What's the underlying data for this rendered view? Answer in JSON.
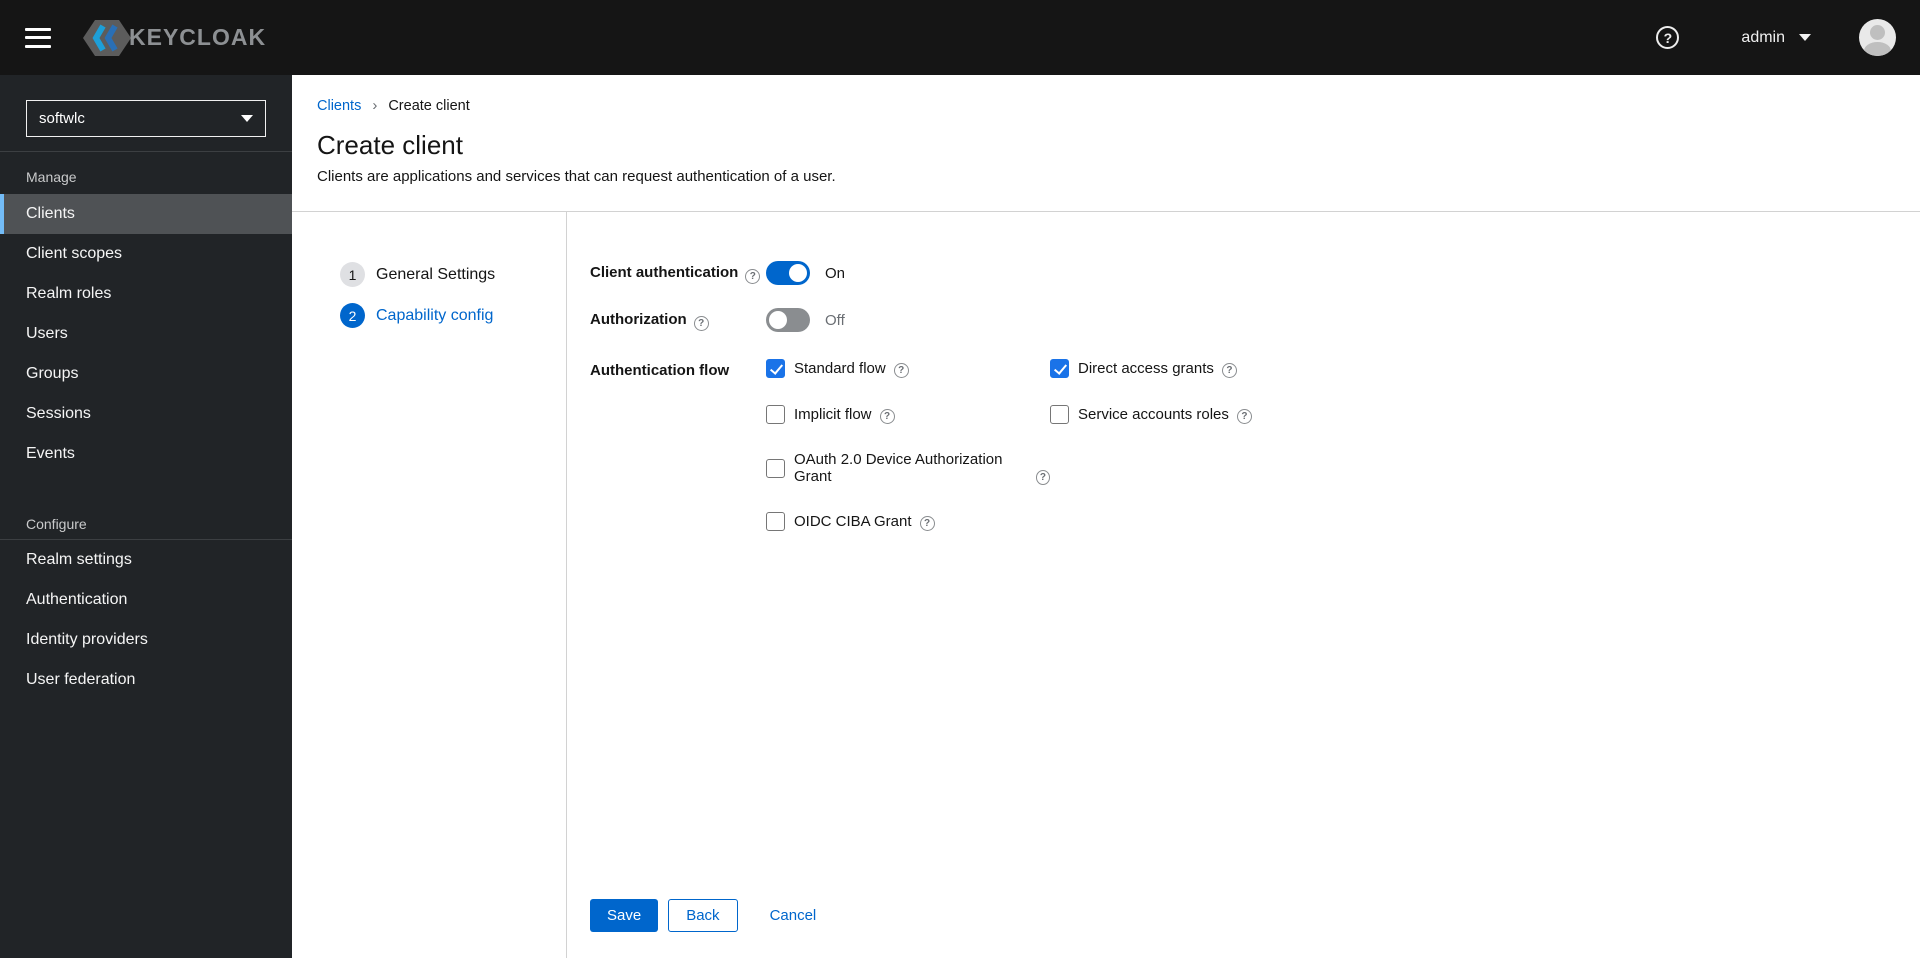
{
  "masthead": {
    "brand": "KEYCLOAK",
    "user": {
      "name": "admin"
    }
  },
  "sidebar": {
    "realm_selector": {
      "value": "softwlc"
    },
    "sections": [
      {
        "title": "Manage",
        "items": [
          {
            "label": "Clients",
            "current": true
          },
          {
            "label": "Client scopes",
            "current": false
          },
          {
            "label": "Realm roles",
            "current": false
          },
          {
            "label": "Users",
            "current": false
          },
          {
            "label": "Groups",
            "current": false
          },
          {
            "label": "Sessions",
            "current": false
          },
          {
            "label": "Events",
            "current": false
          }
        ]
      },
      {
        "title": "Configure",
        "items": [
          {
            "label": "Realm settings",
            "current": false
          },
          {
            "label": "Authentication",
            "current": false
          },
          {
            "label": "Identity providers",
            "current": false
          },
          {
            "label": "User federation",
            "current": false
          }
        ]
      }
    ]
  },
  "breadcrumb": {
    "parent": "Clients",
    "current": "Create client"
  },
  "page_header": {
    "title": "Create client",
    "description": "Clients are applications and services that can request authentication of a user."
  },
  "wizard": {
    "steps": [
      {
        "number": "1",
        "label": "General Settings",
        "current": false
      },
      {
        "number": "2",
        "label": "Capability config",
        "current": true
      }
    ]
  },
  "form": {
    "client_authentication": {
      "label": "Client authentication",
      "state_label": "On",
      "enabled": true
    },
    "authorization": {
      "label": "Authorization",
      "state_label": "Off",
      "enabled": false
    },
    "authentication_flow": {
      "label": "Authentication flow",
      "options": [
        {
          "label": "Standard flow",
          "checked": true
        },
        {
          "label": "Direct access grants",
          "checked": true
        },
        {
          "label": "Implicit flow",
          "checked": false
        },
        {
          "label": "Service accounts roles",
          "checked": false
        },
        {
          "label": "OAuth 2.0 Device Authorization Grant",
          "checked": false
        },
        {
          "label": "OIDC CIBA Grant",
          "checked": false
        }
      ]
    },
    "actions": {
      "save": "Save",
      "back": "Back",
      "cancel": "Cancel"
    }
  },
  "colors": {
    "primary": "#0066cc",
    "checkbox_checked": "#1a73e8",
    "nav_current_accent": "#73bcf7",
    "masthead_bg": "#151515",
    "sidebar_bg": "#212427",
    "divider": "#d2d2d2"
  }
}
